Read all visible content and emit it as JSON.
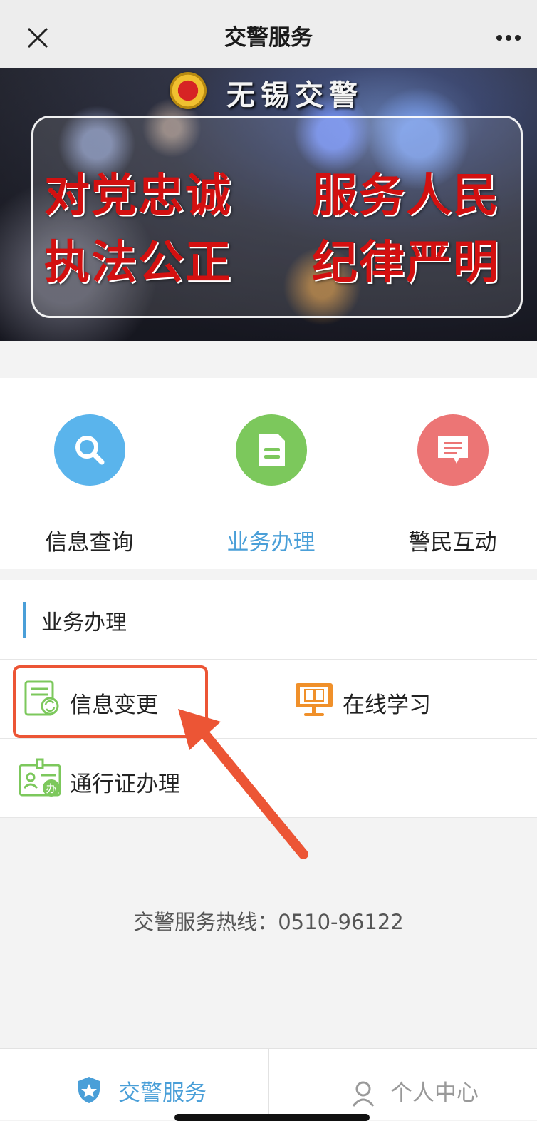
{
  "topbar": {
    "title": "交警服务"
  },
  "banner": {
    "brand": "无锡交警",
    "slogans": [
      "对党忠诚",
      "服务人民",
      "执法公正",
      "纪律严明"
    ]
  },
  "nav": [
    {
      "label": "信息查询",
      "icon": "search-icon",
      "color": "#5ab4ec",
      "active": false
    },
    {
      "label": "业务办理",
      "icon": "document-icon",
      "color": "#7cc85c",
      "active": true
    },
    {
      "label": "警民互动",
      "icon": "chat-icon",
      "color": "#ec7575",
      "active": false
    }
  ],
  "section": {
    "title": "业务办理",
    "items": [
      {
        "label": "信息变更",
        "icon": "info-change-icon"
      },
      {
        "label": "在线学习",
        "icon": "online-study-icon"
      },
      {
        "label": "通行证办理",
        "icon": "pass-card-icon"
      }
    ]
  },
  "hotline": "交警服务热线：0510-96122",
  "tabbar": [
    {
      "label": "交警服务",
      "icon": "police-badge-icon",
      "active": true
    },
    {
      "label": "个人中心",
      "icon": "user-icon",
      "active": false
    }
  ],
  "colors": {
    "accent": "#4a9fd8",
    "highlight": "#ec5535"
  }
}
